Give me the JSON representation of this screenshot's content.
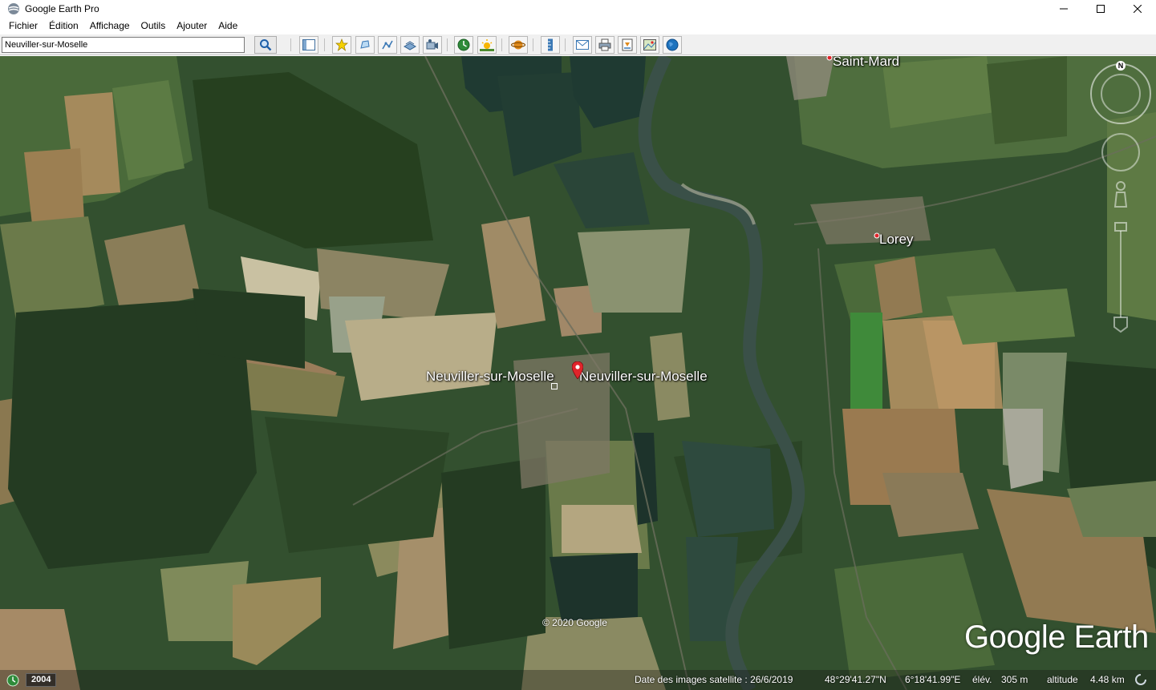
{
  "window": {
    "title": "Google Earth Pro"
  },
  "menu": {
    "items": [
      "Fichier",
      "Édition",
      "Affichage",
      "Outils",
      "Ajouter",
      "Aide"
    ]
  },
  "search": {
    "value": "Neuviller-sur-Moselle"
  },
  "map": {
    "labels": {
      "saint_mard": "Saint-Mard",
      "lorey": "Lorey",
      "neuviller_left": "Neuviller-sur-Moselle",
      "neuviller_right": "Neuviller-sur-Moselle"
    },
    "copyright": "© 2020 Google",
    "brand": "Google Earth",
    "compass_north": "N"
  },
  "status": {
    "year": "2004",
    "imagery_date": "Date des images satellite : 26/6/2019",
    "latitude": "48°29'41.27\"N",
    "longitude": "6°18'41.99\"E",
    "elevation_label": "élév.",
    "elevation_value": "305 m",
    "altitude_label": "altitude",
    "altitude_value": "4.48 km"
  },
  "colors": {
    "accent_blue": "#1e73be",
    "pin_red": "#e0252b",
    "forest_dark": "#253d23",
    "field_light": "#7a7f55"
  }
}
